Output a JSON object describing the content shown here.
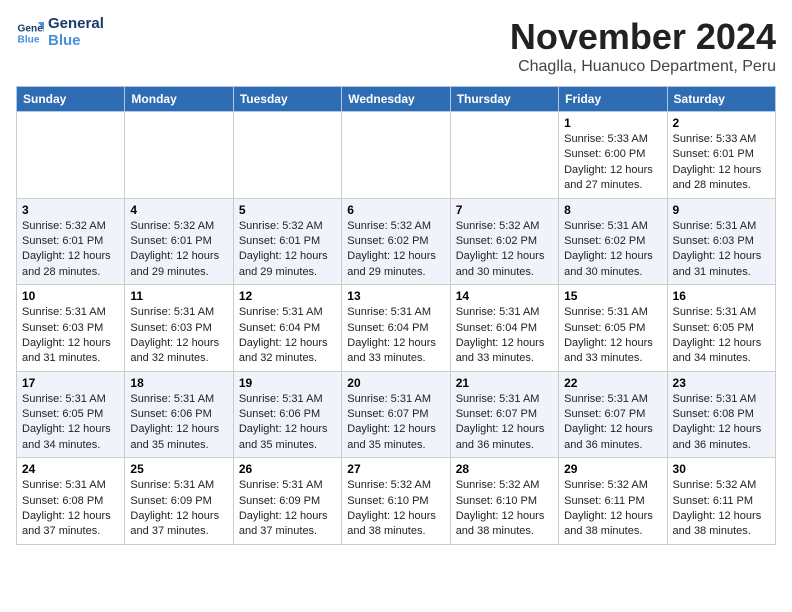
{
  "header": {
    "logo_line1": "General",
    "logo_line2": "Blue",
    "month": "November 2024",
    "location": "Chaglla, Huanuco Department, Peru"
  },
  "weekdays": [
    "Sunday",
    "Monday",
    "Tuesday",
    "Wednesday",
    "Thursday",
    "Friday",
    "Saturday"
  ],
  "weeks": [
    [
      {
        "day": "",
        "info": ""
      },
      {
        "day": "",
        "info": ""
      },
      {
        "day": "",
        "info": ""
      },
      {
        "day": "",
        "info": ""
      },
      {
        "day": "",
        "info": ""
      },
      {
        "day": "1",
        "info": "Sunrise: 5:33 AM\nSunset: 6:00 PM\nDaylight: 12 hours and 27 minutes."
      },
      {
        "day": "2",
        "info": "Sunrise: 5:33 AM\nSunset: 6:01 PM\nDaylight: 12 hours and 28 minutes."
      }
    ],
    [
      {
        "day": "3",
        "info": "Sunrise: 5:32 AM\nSunset: 6:01 PM\nDaylight: 12 hours and 28 minutes."
      },
      {
        "day": "4",
        "info": "Sunrise: 5:32 AM\nSunset: 6:01 PM\nDaylight: 12 hours and 29 minutes."
      },
      {
        "day": "5",
        "info": "Sunrise: 5:32 AM\nSunset: 6:01 PM\nDaylight: 12 hours and 29 minutes."
      },
      {
        "day": "6",
        "info": "Sunrise: 5:32 AM\nSunset: 6:02 PM\nDaylight: 12 hours and 29 minutes."
      },
      {
        "day": "7",
        "info": "Sunrise: 5:32 AM\nSunset: 6:02 PM\nDaylight: 12 hours and 30 minutes."
      },
      {
        "day": "8",
        "info": "Sunrise: 5:31 AM\nSunset: 6:02 PM\nDaylight: 12 hours and 30 minutes."
      },
      {
        "day": "9",
        "info": "Sunrise: 5:31 AM\nSunset: 6:03 PM\nDaylight: 12 hours and 31 minutes."
      }
    ],
    [
      {
        "day": "10",
        "info": "Sunrise: 5:31 AM\nSunset: 6:03 PM\nDaylight: 12 hours and 31 minutes."
      },
      {
        "day": "11",
        "info": "Sunrise: 5:31 AM\nSunset: 6:03 PM\nDaylight: 12 hours and 32 minutes."
      },
      {
        "day": "12",
        "info": "Sunrise: 5:31 AM\nSunset: 6:04 PM\nDaylight: 12 hours and 32 minutes."
      },
      {
        "day": "13",
        "info": "Sunrise: 5:31 AM\nSunset: 6:04 PM\nDaylight: 12 hours and 33 minutes."
      },
      {
        "day": "14",
        "info": "Sunrise: 5:31 AM\nSunset: 6:04 PM\nDaylight: 12 hours and 33 minutes."
      },
      {
        "day": "15",
        "info": "Sunrise: 5:31 AM\nSunset: 6:05 PM\nDaylight: 12 hours and 33 minutes."
      },
      {
        "day": "16",
        "info": "Sunrise: 5:31 AM\nSunset: 6:05 PM\nDaylight: 12 hours and 34 minutes."
      }
    ],
    [
      {
        "day": "17",
        "info": "Sunrise: 5:31 AM\nSunset: 6:05 PM\nDaylight: 12 hours and 34 minutes."
      },
      {
        "day": "18",
        "info": "Sunrise: 5:31 AM\nSunset: 6:06 PM\nDaylight: 12 hours and 35 minutes."
      },
      {
        "day": "19",
        "info": "Sunrise: 5:31 AM\nSunset: 6:06 PM\nDaylight: 12 hours and 35 minutes."
      },
      {
        "day": "20",
        "info": "Sunrise: 5:31 AM\nSunset: 6:07 PM\nDaylight: 12 hours and 35 minutes."
      },
      {
        "day": "21",
        "info": "Sunrise: 5:31 AM\nSunset: 6:07 PM\nDaylight: 12 hours and 36 minutes."
      },
      {
        "day": "22",
        "info": "Sunrise: 5:31 AM\nSunset: 6:07 PM\nDaylight: 12 hours and 36 minutes."
      },
      {
        "day": "23",
        "info": "Sunrise: 5:31 AM\nSunset: 6:08 PM\nDaylight: 12 hours and 36 minutes."
      }
    ],
    [
      {
        "day": "24",
        "info": "Sunrise: 5:31 AM\nSunset: 6:08 PM\nDaylight: 12 hours and 37 minutes."
      },
      {
        "day": "25",
        "info": "Sunrise: 5:31 AM\nSunset: 6:09 PM\nDaylight: 12 hours and 37 minutes."
      },
      {
        "day": "26",
        "info": "Sunrise: 5:31 AM\nSunset: 6:09 PM\nDaylight: 12 hours and 37 minutes."
      },
      {
        "day": "27",
        "info": "Sunrise: 5:32 AM\nSunset: 6:10 PM\nDaylight: 12 hours and 38 minutes."
      },
      {
        "day": "28",
        "info": "Sunrise: 5:32 AM\nSunset: 6:10 PM\nDaylight: 12 hours and 38 minutes."
      },
      {
        "day": "29",
        "info": "Sunrise: 5:32 AM\nSunset: 6:11 PM\nDaylight: 12 hours and 38 minutes."
      },
      {
        "day": "30",
        "info": "Sunrise: 5:32 AM\nSunset: 6:11 PM\nDaylight: 12 hours and 38 minutes."
      }
    ]
  ]
}
